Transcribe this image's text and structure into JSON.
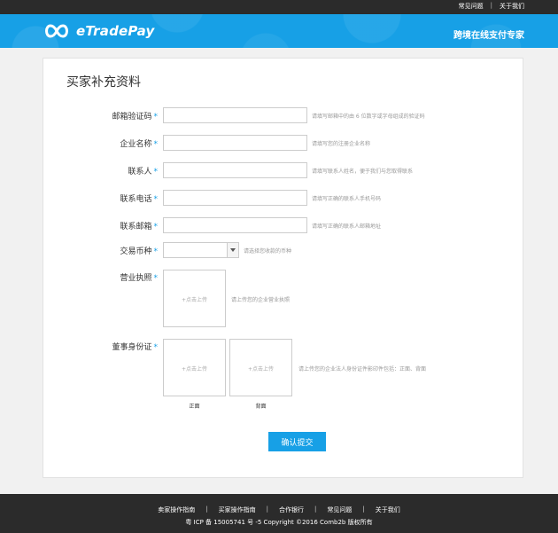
{
  "topbar": {
    "faq": "常见问题",
    "separator": "|",
    "about": "关于我们"
  },
  "header": {
    "logo_text": "eTradePay",
    "tagline": "跨境在线支付专家"
  },
  "form": {
    "title": "买家补充资料",
    "required_mark": "*",
    "fields": {
      "email_code": {
        "label": "邮箱验证码",
        "value": "",
        "hint": "请填写邮箱中的由 6 位数字或字母组成的验证码"
      },
      "company": {
        "label": "企业名称",
        "value": "",
        "hint": "请填写您的注册企业名称"
      },
      "contact": {
        "label": "联系人",
        "value": "",
        "hint": "请填写联系人姓名，便于我们与您取得联系"
      },
      "phone": {
        "label": "联系电话",
        "value": "",
        "hint": "请填写正确的联系人手机号码"
      },
      "email": {
        "label": "联系邮箱",
        "value": "",
        "hint": "请填写正确的联系人邮箱地址"
      },
      "currency": {
        "label": "交易币种",
        "value": "",
        "hint": "请选择您收款的币种"
      },
      "license": {
        "label": "营业执照",
        "upload_text": "+点击上传",
        "hint": "请上传您的企业营业执照"
      },
      "id_card": {
        "label": "董事身份证",
        "upload_text": "+点击上传",
        "hint": "请上传您的企业法人身份证件影印件包括：正面、背面",
        "front_caption": "正面",
        "back_caption": "背面"
      }
    },
    "submit_label": "确认提交"
  },
  "footer": {
    "links": [
      "卖家操作指南",
      "买家操作指南",
      "合作银行",
      "常见问题",
      "关于我们"
    ],
    "separator": "|",
    "copyright": "粤 ICP 备 15005741 号 -5 Copyright ©2016 Comb2b 版权所有"
  },
  "colors": {
    "brand": "#17a0e6",
    "dark_bar": "#2b2b2b"
  },
  "icons": {
    "logo": "infinity-logo-icon",
    "select": "chevron-down-icon"
  }
}
